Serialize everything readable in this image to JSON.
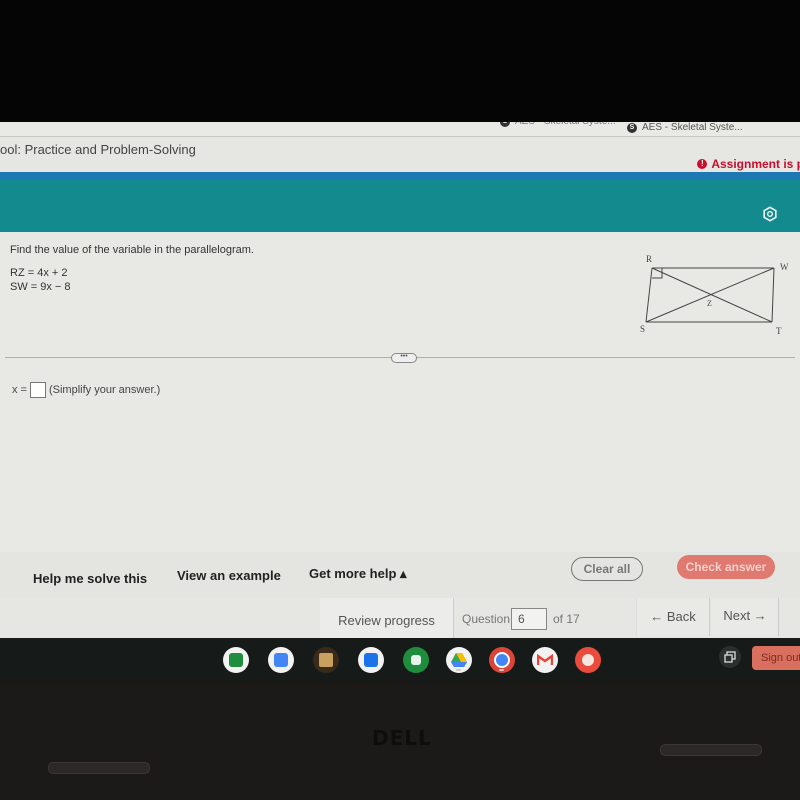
{
  "browser": {
    "bookmarks": [
      {
        "icon": "s-favicon",
        "label": "AES - Skeletal Syste..."
      },
      {
        "icon": "s-favicon",
        "label": "AES - Skeletal Syste..."
      }
    ]
  },
  "header": {
    "title": "ool: Practice and Problem-Solving",
    "status": "Assignment is p",
    "status_icon": "alert-icon",
    "settings_icon": "gear-icon",
    "colors": {
      "status": "#c8102e",
      "topbar": "#128a8e",
      "accent": "#1e78b4"
    }
  },
  "question": {
    "prompt": "Find the value of the variable in the parallelogram.",
    "equations": [
      "RZ = 4x + 2",
      "SW = 9x − 8"
    ],
    "figure": {
      "vertex_labels": {
        "top_left": "R",
        "top_right": "W",
        "bottom_left": "S",
        "bottom_right": "T",
        "center": "Z"
      },
      "right_angle_marker": "R"
    },
    "more_handle": "•••",
    "answer_label": "x =",
    "answer_value": "",
    "answer_hint": "(Simplify your answer.)"
  },
  "help": {
    "help_me_solve": "Help me solve this",
    "view_example": "View an example",
    "get_more_help": "Get more help ▴",
    "clear_all": "Clear all",
    "check_answer": "Check answer",
    "colors": {
      "check_answer": "#e07a70"
    }
  },
  "navigation": {
    "review_progress": "Review progress",
    "question_label": "Question",
    "question_number": "6",
    "of_total": "of 17",
    "back": "← Back",
    "next": "Next →"
  },
  "shelf": {
    "apps": [
      "sheets-icon",
      "docs-icon",
      "kindle-icon",
      "screencast-icon",
      "calculator-icon",
      "drive-icon",
      "chrome-icon",
      "gmail-icon",
      "canvas-icon"
    ],
    "signout": "Sign out"
  },
  "device": {
    "logo": "DELL"
  }
}
